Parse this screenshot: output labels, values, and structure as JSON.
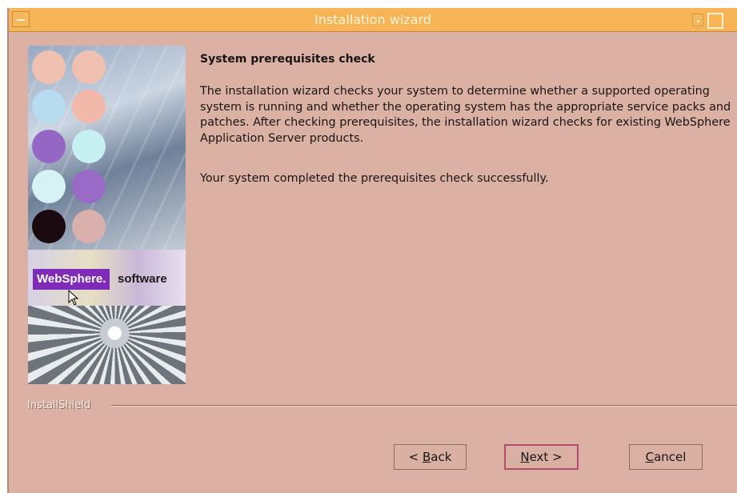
{
  "window": {
    "title": "Installation wizard"
  },
  "sidebar_image": {
    "brand_name": "WebSphere.",
    "brand_suffix": "software"
  },
  "content": {
    "heading": "System prerequisites check",
    "description": "The installation wizard checks your system to determine whether a supported operating system is running and whether the operating system has the appropriate service packs and patches. After checking prerequisites, the installation wizard checks for existing WebSphere Application Server products.",
    "status": "Your system completed the prerequisites check successfully."
  },
  "footer": {
    "separator_label": "InstallShield"
  },
  "buttons": {
    "back": {
      "prefix": "< ",
      "mnemonic": "B",
      "rest": "ack"
    },
    "next": {
      "mnemonic": "N",
      "rest": "ext >"
    },
    "cancel": {
      "mnemonic": "C",
      "rest": "ancel"
    }
  },
  "colors": {
    "titlebar": "#f6b456",
    "dialog_bg": "#dbb1a3",
    "websphere_purple": "#7d2bb8",
    "default_button_border": "#b44b6f"
  }
}
